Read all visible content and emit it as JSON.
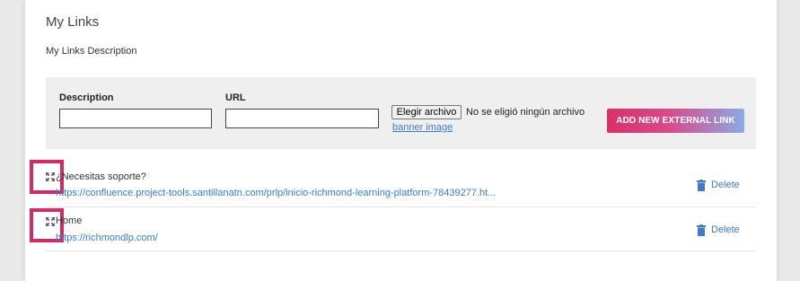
{
  "section": {
    "title": "My Links",
    "description": "My Links Description"
  },
  "form": {
    "description_label": "Description",
    "description_value": "",
    "url_label": "URL",
    "url_value": "",
    "file_button": "Elegir archivo",
    "file_status": "No se eligió ningún archivo",
    "banner_link": "banner image",
    "add_button": "ADD NEW EXTERNAL LINK"
  },
  "links": [
    {
      "name": "¿Necesitas soporte?",
      "url": "https://confluence.project-tools.santillanatn.com/prlp/inicio-richmond-learning-platform-78439277.ht...",
      "delete_label": "Delete",
      "drag_icon": "move-arrows-icon",
      "delete_icon": "trash-icon"
    },
    {
      "name": "Home",
      "url": "https://richmondlp.com/",
      "delete_label": "Delete",
      "drag_icon": "move-arrows-icon",
      "delete_icon": "trash-icon"
    }
  ],
  "colors": {
    "highlight": "#d22a66",
    "link": "#3d7bc4",
    "button_gradient_start": "#d9306a",
    "button_gradient_end": "#8aaae8"
  }
}
